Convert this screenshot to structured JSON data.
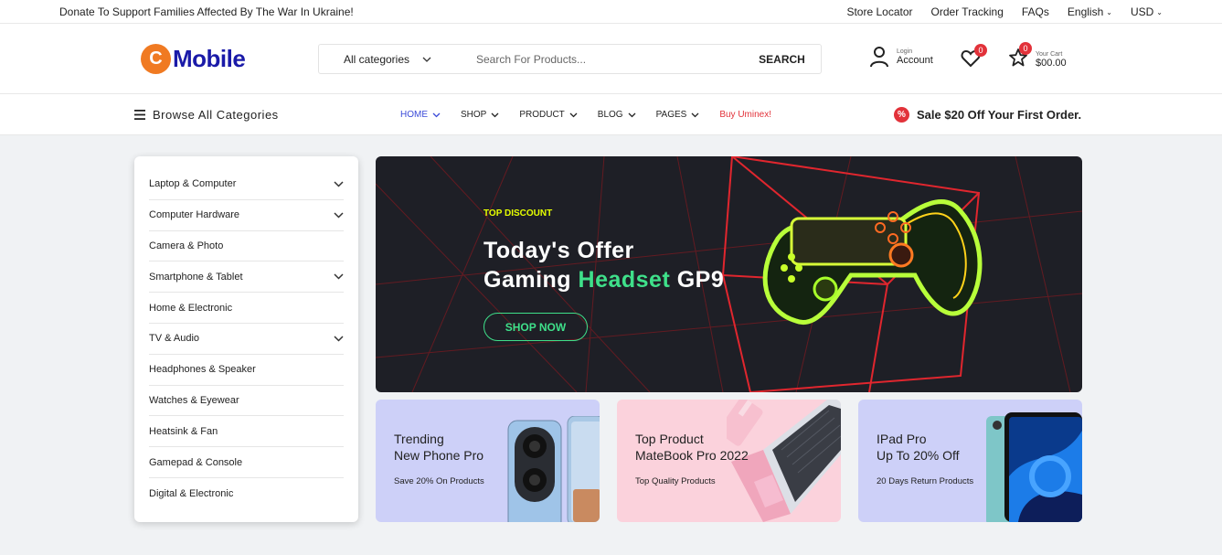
{
  "topbar": {
    "donate": "Donate To Support Families Affected By The War In Ukraine!",
    "store_locator": "Store Locator",
    "order_tracking": "Order Tracking",
    "faqs": "FAQs",
    "language": "English",
    "currency": "USD"
  },
  "header": {
    "logo_text": "Mobile",
    "category_select": "All categories",
    "search_placeholder": "Search For Products...",
    "search_button": "SEARCH",
    "login_label": "Login",
    "account_label": "Account",
    "wishlist_count": "0",
    "cart_count": "0",
    "cart_label": "Your Cart",
    "cart_total": "$00.00"
  },
  "nav": {
    "browse": "Browse All Categories",
    "items": [
      {
        "label": "HOME"
      },
      {
        "label": "SHOP"
      },
      {
        "label": "PRODUCT"
      },
      {
        "label": "BLOG"
      },
      {
        "label": "PAGES"
      },
      {
        "label": "Buy Uminex!"
      }
    ],
    "sale_text": "Sale $20 Off Your First Order."
  },
  "sidebar": {
    "items": [
      {
        "label": "Laptop & Computer",
        "expandable": true
      },
      {
        "label": "Computer Hardware",
        "expandable": true
      },
      {
        "label": "Camera & Photo",
        "expandable": false
      },
      {
        "label": "Smartphone & Tablet",
        "expandable": true
      },
      {
        "label": "Home & Electronic",
        "expandable": false
      },
      {
        "label": "TV & Audio",
        "expandable": true
      },
      {
        "label": "Headphones & Speaker",
        "expandable": false
      },
      {
        "label": "Watches & Eyewear",
        "expandable": false
      },
      {
        "label": "Heatsink & Fan",
        "expandable": false
      },
      {
        "label": "Gamepad & Console",
        "expandable": false
      },
      {
        "label": "Digital & Electronic",
        "expandable": false
      }
    ]
  },
  "hero": {
    "tag": "TOP DISCOUNT",
    "line1": "Today's Offer",
    "line2_prefix": "Gaming ",
    "line2_highlight": "Headset",
    "line2_suffix": " GP9",
    "button": "SHOP NOW"
  },
  "cards": [
    {
      "line1": "Trending",
      "line2": "New Phone Pro",
      "sub": "Save 20% On Products"
    },
    {
      "line1": "Top Product",
      "line2": "MateBook Pro 2022",
      "sub": "Top Quality Products"
    },
    {
      "line1": "IPad Pro",
      "line2": "Up To 20% Off",
      "sub": "20 Days Return Products"
    }
  ],
  "colors": {
    "accent_blue": "#3b4bd8",
    "accent_red": "#e2323a",
    "hero_green": "#3fe08a",
    "hero_tag": "#e6ff00",
    "logo_orange": "#f07a22"
  }
}
